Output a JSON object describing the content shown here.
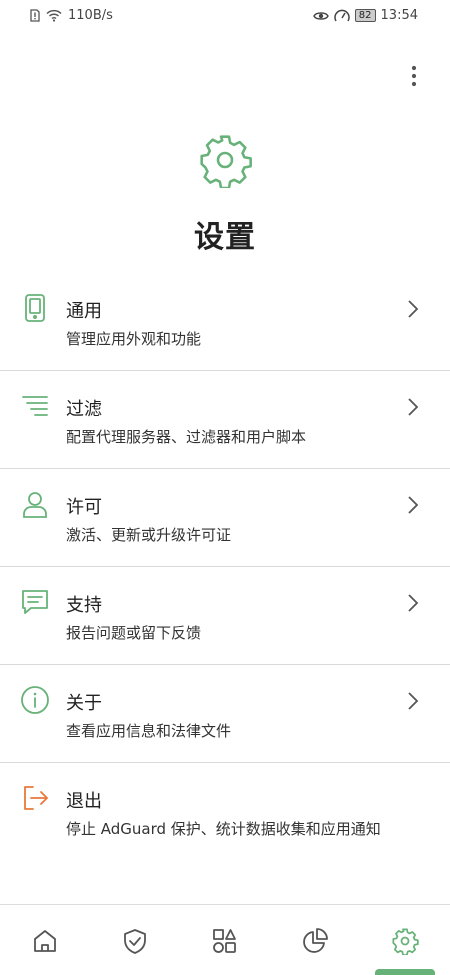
{
  "status_bar": {
    "network_speed": "110B/s",
    "battery": "82",
    "time": "13:54"
  },
  "colors": {
    "accent_green": "#67b279",
    "logout_orange": "#e8793a"
  },
  "header": {
    "icon": "gear-icon",
    "title": "设置"
  },
  "menu": {
    "items": [
      {
        "icon": "phone-icon",
        "title": "通用",
        "subtitle": "管理应用外观和功能"
      },
      {
        "icon": "filter-lines-icon",
        "title": "过滤",
        "subtitle": "配置代理服务器、过滤器和用户脚本"
      },
      {
        "icon": "user-icon",
        "title": "许可",
        "subtitle": "激活、更新或升级许可证"
      },
      {
        "icon": "chat-icon",
        "title": "支持",
        "subtitle": "报告问题或留下反馈"
      },
      {
        "icon": "info-icon",
        "title": "关于",
        "subtitle": "查看应用信息和法律文件"
      },
      {
        "icon": "logout-icon",
        "title": "退出",
        "subtitle": "停止 AdGuard 保护、统计数据收集和应用通知"
      }
    ]
  },
  "bottom_nav": {
    "tabs": [
      {
        "icon": "home-icon"
      },
      {
        "icon": "shield-check-icon"
      },
      {
        "icon": "apps-grid-icon"
      },
      {
        "icon": "pie-chart-icon"
      },
      {
        "icon": "settings-gear-icon",
        "active": true
      }
    ]
  }
}
